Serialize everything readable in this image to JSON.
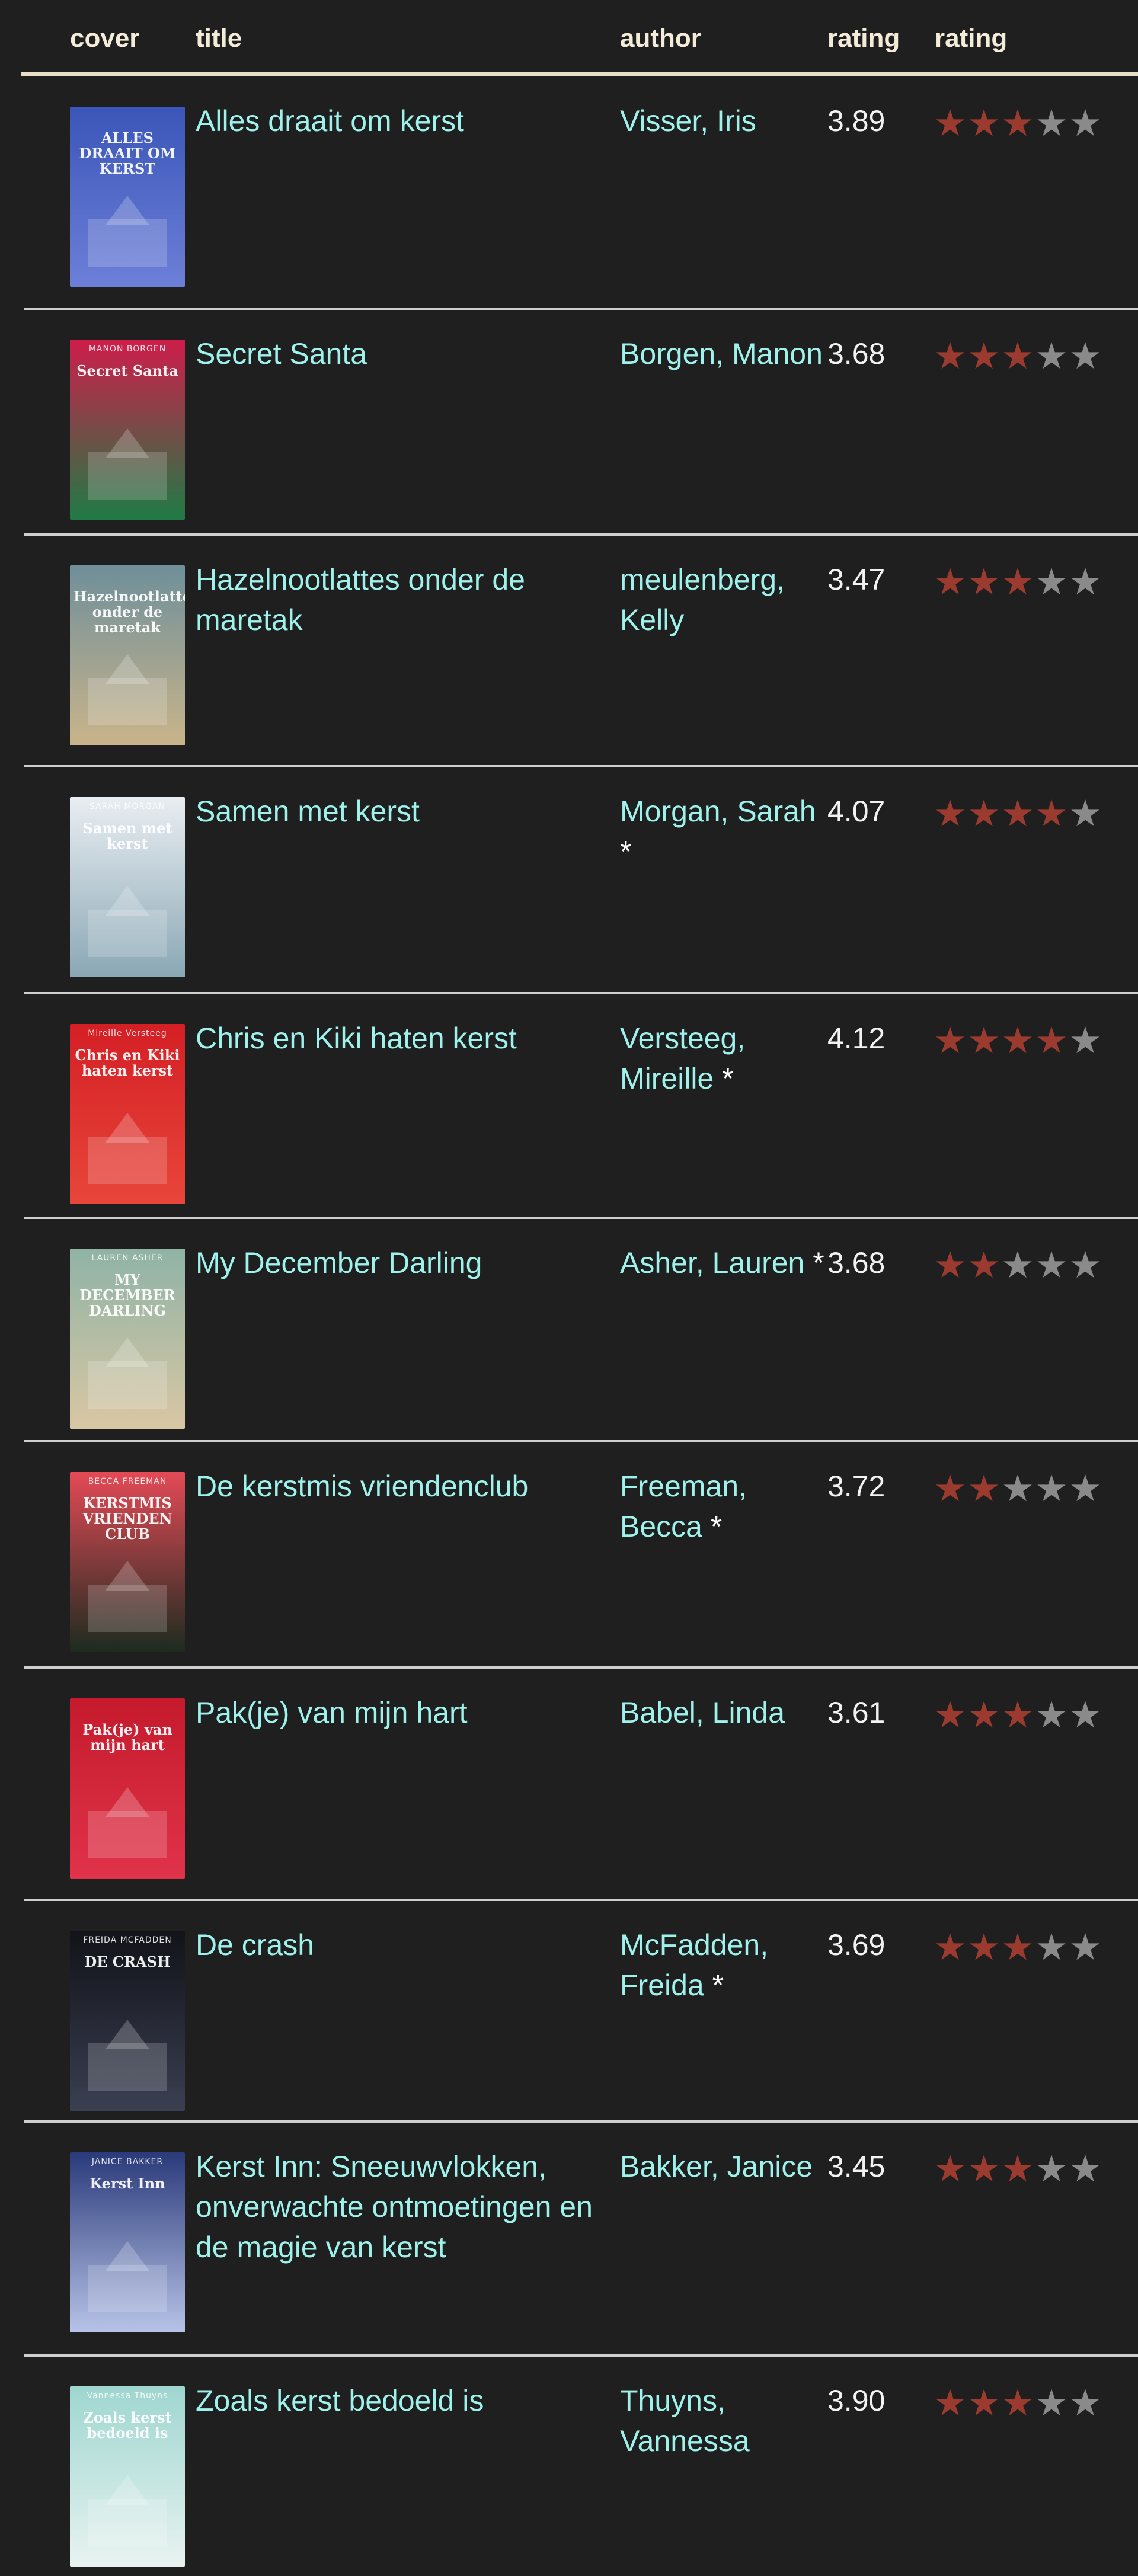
{
  "header": {
    "cover": "cover",
    "title": "title",
    "author": "author",
    "avg_rating": "rating",
    "my_rating": "rating"
  },
  "colors": {
    "background": "#1f1f1f",
    "link": "#9ff2ec",
    "header_text": "#f4ecd8",
    "star_on": "#9b3a2e",
    "star_off": "#8a8a8a"
  },
  "books": [
    {
      "title": "Alles draait om kerst",
      "author": "Visser, Iris",
      "author_star": "",
      "avg_rating": "3.89",
      "my_rating": 3,
      "cover_title": "ALLES DRAAIT OM KERST",
      "cover_author": "",
      "cover_colors": [
        "#3a56b8",
        "#6d7fd8"
      ]
    },
    {
      "title": "Secret Santa",
      "author": "Borgen, Manon",
      "author_star": "",
      "avg_rating": "3.68",
      "my_rating": 3,
      "cover_title": "Secret Santa",
      "cover_author": "MANON BORGEN",
      "cover_colors": [
        "#cf1d4a",
        "#1f7a45"
      ]
    },
    {
      "title": "Hazelnootlattes onder de maretak",
      "author": "meulenberg, Kelly",
      "author_star": "",
      "avg_rating": "3.47",
      "my_rating": 3,
      "cover_title": "Hazelnootlattes onder de maretak",
      "cover_author": "",
      "cover_colors": [
        "#6f8f9a",
        "#c9b48a"
      ]
    },
    {
      "title": "Samen met kerst",
      "author": "Morgan, Sarah",
      "author_star": "*",
      "avg_rating": "4.07",
      "my_rating": 4,
      "cover_title": "Samen met kerst",
      "cover_author": "SARAH MORGAN",
      "cover_colors": [
        "#e9eef2",
        "#8aa7b5"
      ]
    },
    {
      "title": "Chris en Kiki haten kerst",
      "author": "Versteeg, Mireille",
      "author_star": "*",
      "avg_rating": "4.12",
      "my_rating": 4,
      "cover_title": "Chris en Kiki haten kerst",
      "cover_author": "Mireille Versteeg",
      "cover_colors": [
        "#d41f25",
        "#e8463a"
      ]
    },
    {
      "title": "My December Darling",
      "author": "Asher, Lauren",
      "author_star": "*",
      "avg_rating": "3.68",
      "my_rating": 2,
      "cover_title": "MY DECEMBER DARLING",
      "cover_author": "LAUREN ASHER",
      "cover_colors": [
        "#8fb3a6",
        "#d9c7a3"
      ]
    },
    {
      "title": "De kerstmis vriendenclub",
      "author": "Freeman, Becca",
      "author_star": "*",
      "avg_rating": "3.72",
      "my_rating": 2,
      "cover_title": "KERSTMIS VRIENDEN CLUB",
      "cover_author": "BECCA FREEMAN",
      "cover_colors": [
        "#e44a56",
        "#1c2b1f"
      ]
    },
    {
      "title": "Pak(je) van mijn hart",
      "author": "Babel, Linda",
      "author_star": "",
      "avg_rating": "3.61",
      "my_rating": 3,
      "cover_title": "Pak(je) van mijn hart",
      "cover_author": "",
      "cover_colors": [
        "#c51a2c",
        "#e0334a"
      ]
    },
    {
      "title": "De crash",
      "author": "McFadden, Freida",
      "author_star": "*",
      "avg_rating": "3.69",
      "my_rating": 3,
      "cover_title": "DE CRASH",
      "cover_author": "FREIDA MCFADDEN",
      "cover_colors": [
        "#111318",
        "#3a3f52"
      ]
    },
    {
      "title": "Kerst Inn: Sneeuwvlokken, onverwachte ontmoetingen en de magie van kerst",
      "author": "Bakker, Janice",
      "author_star": "",
      "avg_rating": "3.45",
      "my_rating": 3,
      "cover_title": "Kerst Inn",
      "cover_author": "JANICE BAKKER",
      "cover_colors": [
        "#2a3a7a",
        "#b7c3e8"
      ]
    },
    {
      "title": "Zoals kerst bedoeld is",
      "author": "Thuyns, Vannessa",
      "author_star": "",
      "avg_rating": "3.90",
      "my_rating": 3,
      "cover_title": "Zoals kerst bedoeld is",
      "cover_author": "Vannessa Thuyns",
      "cover_colors": [
        "#9fd6d0",
        "#e8f3f1"
      ]
    }
  ]
}
